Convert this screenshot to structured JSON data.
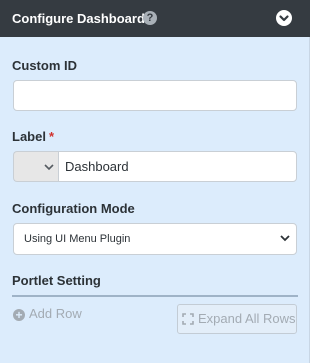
{
  "header": {
    "title": "Configure Dashboard",
    "help_icon": "question-circle-icon",
    "collapse_icon": "chevron-circle-down-icon"
  },
  "fields": {
    "custom_id": {
      "label": "Custom ID",
      "value": "",
      "placeholder": ""
    },
    "label": {
      "label": "Label",
      "required_marker": "*",
      "language_selector_value": "",
      "value": "Dashboard"
    },
    "configuration_mode": {
      "label": "Configuration Mode",
      "selected": "Using UI Menu Plugin"
    }
  },
  "portlet": {
    "section_title": "Portlet Setting",
    "add_row_label": "Add Row",
    "expand_all_label": "Expand All Rows"
  },
  "colors": {
    "header_bg": "#353b41",
    "panel_bg": "#dcecfc",
    "required": "#d0312d",
    "disabled_text": "#a3abb3"
  }
}
